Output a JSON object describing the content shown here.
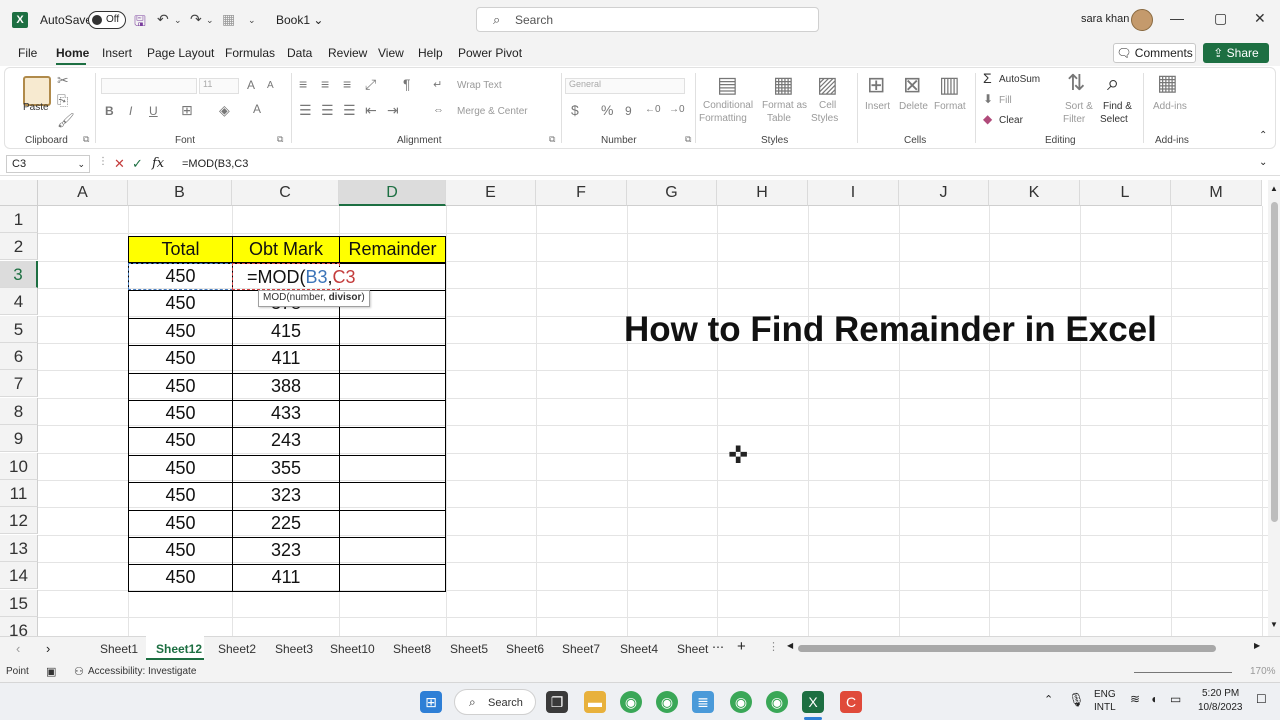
{
  "window": {
    "autosave_label": "AutoSave",
    "autosave_state": "Off",
    "book_name": "Book1",
    "search_placeholder": "Search",
    "user_name": "sara khan"
  },
  "menu": {
    "tabs": [
      "File",
      "Home",
      "Insert",
      "Page Layout",
      "Formulas",
      "Data",
      "Review",
      "View",
      "Help",
      "Power Pivot"
    ],
    "comments_label": "Comments",
    "share_label": "Share"
  },
  "ribbon": {
    "clipboard": {
      "label": "Clipboard",
      "paste": "Paste"
    },
    "font": {
      "label": "Font",
      "size": "11"
    },
    "alignment": {
      "label": "Alignment",
      "wrap": "Wrap Text",
      "merge": "Merge & Center"
    },
    "number": {
      "label": "Number",
      "format": "General"
    },
    "styles": {
      "label": "Styles",
      "cond_1": "Conditional",
      "cond_2": "Formatting",
      "fmt_1": "Format as",
      "fmt_2": "Table",
      "cell_1": "Cell",
      "cell_2": "Styles"
    },
    "cells": {
      "label": "Cells",
      "insert": "Insert",
      "delete": "Delete",
      "format": "Format"
    },
    "editing": {
      "label": "Editing",
      "autosum": "AutoSum",
      "fill": "Fill",
      "clear": "Clear",
      "sort_1": "Sort &",
      "sort_2": "Filter",
      "find_1": "Find &",
      "find_2": "Select"
    },
    "addins": {
      "label": "Add-ins",
      "button": "Add-ins"
    }
  },
  "formula_bar": {
    "name_box": "C3",
    "formula": "=MOD(B3,C3"
  },
  "grid": {
    "columns": [
      "A",
      "B",
      "C",
      "D",
      "E",
      "F",
      "G",
      "H",
      "I",
      "J",
      "K",
      "L",
      "M"
    ],
    "rows": [
      "1",
      "2",
      "3",
      "4",
      "5",
      "6",
      "7",
      "8",
      "9",
      "10",
      "11",
      "12",
      "13",
      "14",
      "15",
      "16"
    ],
    "table_headers": [
      "Total",
      "Obt Mark",
      "Remainder"
    ],
    "total_values": [
      "450",
      "450",
      "450",
      "450",
      "450",
      "450",
      "450",
      "450",
      "450",
      "450",
      "450",
      "450"
    ],
    "obt_values": [
      "",
      "378",
      "415",
      "411",
      "388",
      "433",
      "243",
      "355",
      "323",
      "225",
      "323",
      "411"
    ],
    "edit_prefix": "=MOD(",
    "edit_ref_b": "B3",
    "edit_comma": ",",
    "edit_ref_c": "C3",
    "tooltip_fn": "MOD(number, ",
    "tooltip_arg": "divisor",
    "tooltip_end": ")",
    "overlay_title": "How to Find Remainder in Excel"
  },
  "sheets": [
    "Sheet1",
    "Sheet12",
    "Sheet2",
    "Sheet3",
    "Sheet10",
    "Sheet8",
    "Sheet5",
    "Sheet6",
    "Sheet7",
    "Sheet4",
    "Sheet"
  ],
  "status": {
    "mode": "Point",
    "accessibility": "Accessibility: Investigate",
    "zoom": "170%"
  },
  "taskbar": {
    "search": "Search",
    "lang_1": "ENG",
    "lang_2": "INTL",
    "time": "5:20 PM",
    "date": "10/8/2023"
  },
  "colors": {
    "excel_green": "#1d6f42",
    "header_yellow": "#ffff00"
  }
}
